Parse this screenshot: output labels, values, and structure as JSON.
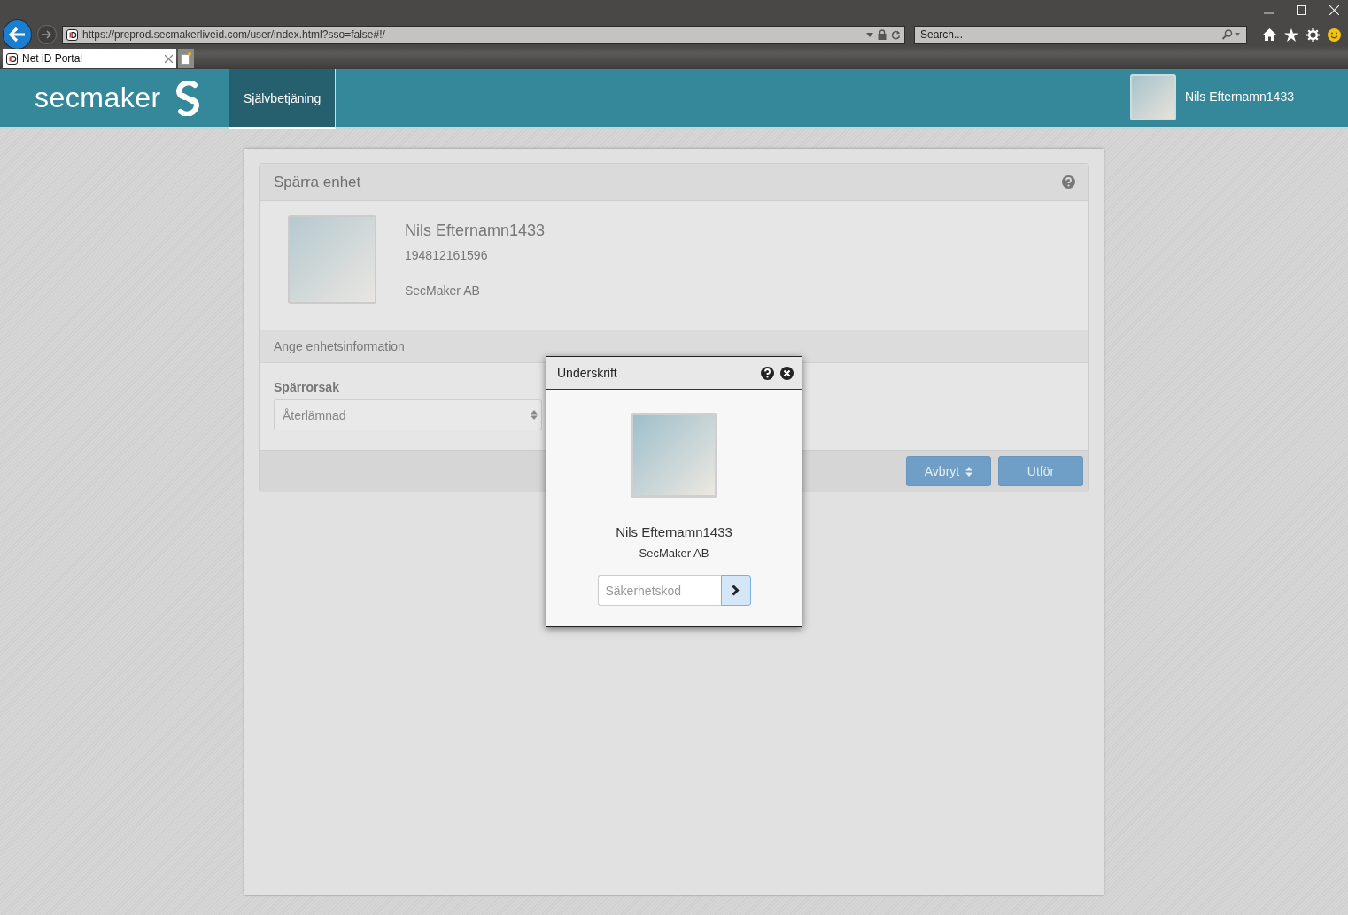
{
  "browser": {
    "address": "https://preprod.secmakerliveid.com/user/index.html?sso=false#!/",
    "search_placeholder": "Search...",
    "tabs": [
      {
        "title": "Net iD Portal",
        "selected": true
      }
    ]
  },
  "header": {
    "logo": "secmaker",
    "nav": [
      {
        "label": "Självbetjäning",
        "selected": true
      }
    ],
    "user_name": "Nils Efternamn1433"
  },
  "panel": {
    "title": "Spärra enhet",
    "person": {
      "name": "Nils Efternamn1433",
      "id": "194812161596",
      "organization": "SecMaker AB"
    },
    "section_title": "Ange enhetsinformation",
    "field": {
      "label": "Spärrorsak",
      "value": "Återlämnad"
    },
    "buttons": [
      {
        "label": "Avbryt",
        "kind": "sort"
      },
      {
        "label": "Utför",
        "kind": "plain"
      }
    ]
  },
  "dialog": {
    "title": "Underskrift",
    "name": "Nils Efternamn1433",
    "organization": "SecMaker AB",
    "code_placeholder": "Säkerhetskod"
  }
}
